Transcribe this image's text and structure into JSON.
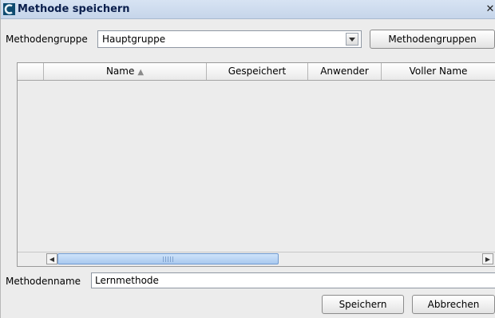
{
  "window": {
    "title": "Methode speichern",
    "close_glyph": "✕"
  },
  "group": {
    "label": "Methodengruppe",
    "selected": "Hauptgruppe",
    "groups_button": "Methodengruppen"
  },
  "table": {
    "columns": [
      "",
      "Name",
      "Gespeichert",
      "Anwender",
      "Voller Name"
    ],
    "sort_column": "Name",
    "sort_direction": "ascending",
    "rows": []
  },
  "name": {
    "label": "Methodenname",
    "value": "Lernmethode"
  },
  "actions": {
    "save": "Speichern",
    "cancel": "Abbrechen"
  },
  "icons": {
    "app": "app-logo-icon",
    "dropdown": "chevron-down-icon",
    "sort": "sort-ascending-icon",
    "scroll_left": "arrow-left-icon",
    "scroll_right": "arrow-right-icon",
    "close": "close-icon"
  },
  "scroll": {
    "thumb_fraction": 0.52,
    "position_fraction": 0.0
  },
  "colors": {
    "titlebar": "#c6d5ea",
    "title_text": "#0b1f4d",
    "scroll_thumb": "#a9c9ef"
  }
}
